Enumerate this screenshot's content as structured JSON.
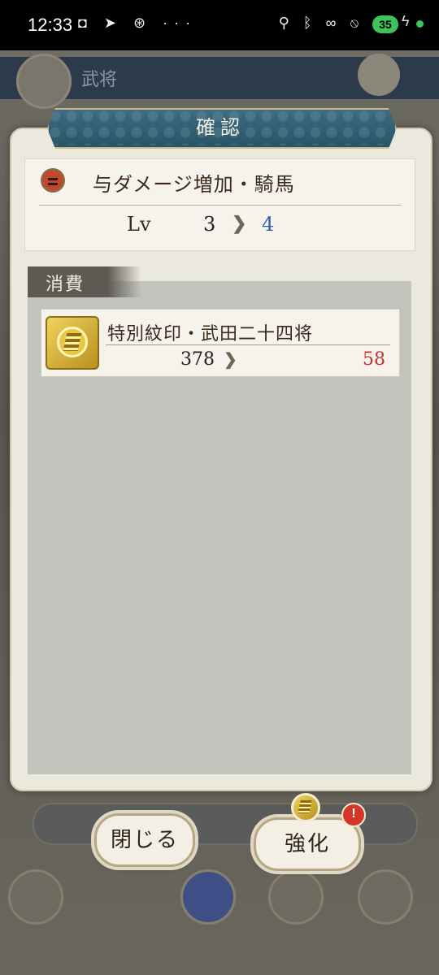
{
  "status_bar": {
    "time": "12:33",
    "left_icons": [
      "game-controller-icon",
      "telegram-icon",
      "vpn-icon",
      "more-icon"
    ],
    "more_text": "···",
    "battery": "35"
  },
  "background": {
    "header_title": "武将"
  },
  "dialog": {
    "title": "確認",
    "skill": {
      "name": "与ダメージ増加・騎馬",
      "lv_label": "Lv",
      "lv_from": "3",
      "lv_arrow": "❯",
      "lv_to": "4"
    },
    "consume": {
      "label": "消費",
      "items": [
        {
          "name": "特別紋印・武田二十四将",
          "from": "378",
          "arrow": "❯",
          "to": "58"
        }
      ]
    }
  },
  "buttons": {
    "close_label": "閉じる",
    "enhance_label": "強化",
    "alert_mark": "!"
  },
  "colors": {
    "title_banner": "#2a5468",
    "level_up": "#2c5fa8",
    "remaining_low": "#c0362b",
    "dialog_bg": "#ebe8dd"
  }
}
